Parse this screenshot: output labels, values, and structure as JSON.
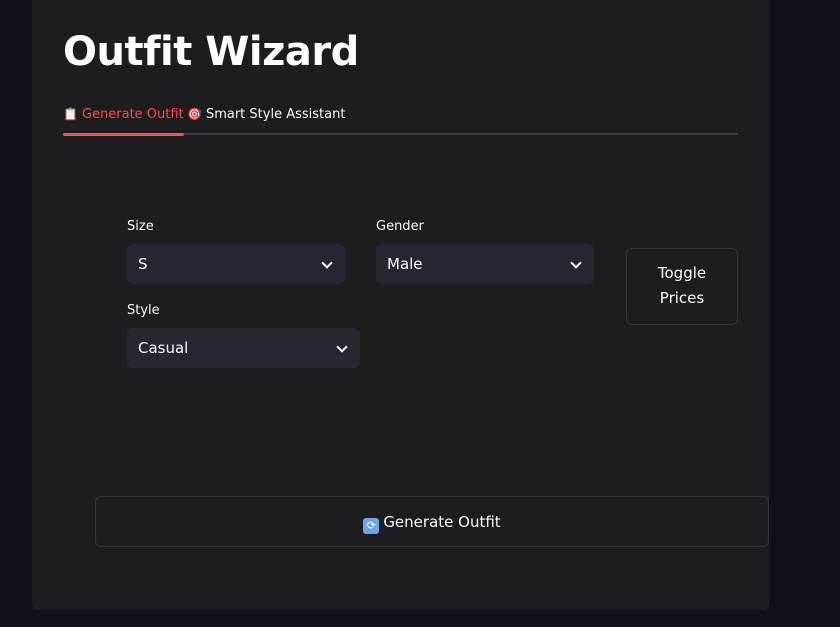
{
  "app": {
    "title": "Outfit Wizard"
  },
  "tabs": [
    {
      "label": "Generate Outfit",
      "icon": "clipboard-icon",
      "active": true
    },
    {
      "label": "Smart Style Assistant",
      "icon": "dart-icon",
      "active": false
    }
  ],
  "form": {
    "size": {
      "label": "Size",
      "value": "S"
    },
    "gender": {
      "label": "Gender",
      "value": "Male"
    },
    "style": {
      "label": "Style",
      "value": "Casual"
    }
  },
  "buttons": {
    "toggle_prices": "Toggle Prices",
    "generate_outfit": "Generate Outfit",
    "generate_icon": "refresh-icon"
  },
  "colors": {
    "accent": "#ff4b4b",
    "background": "#0e1117",
    "panel": "#1d1d1f",
    "input": "#262730"
  }
}
